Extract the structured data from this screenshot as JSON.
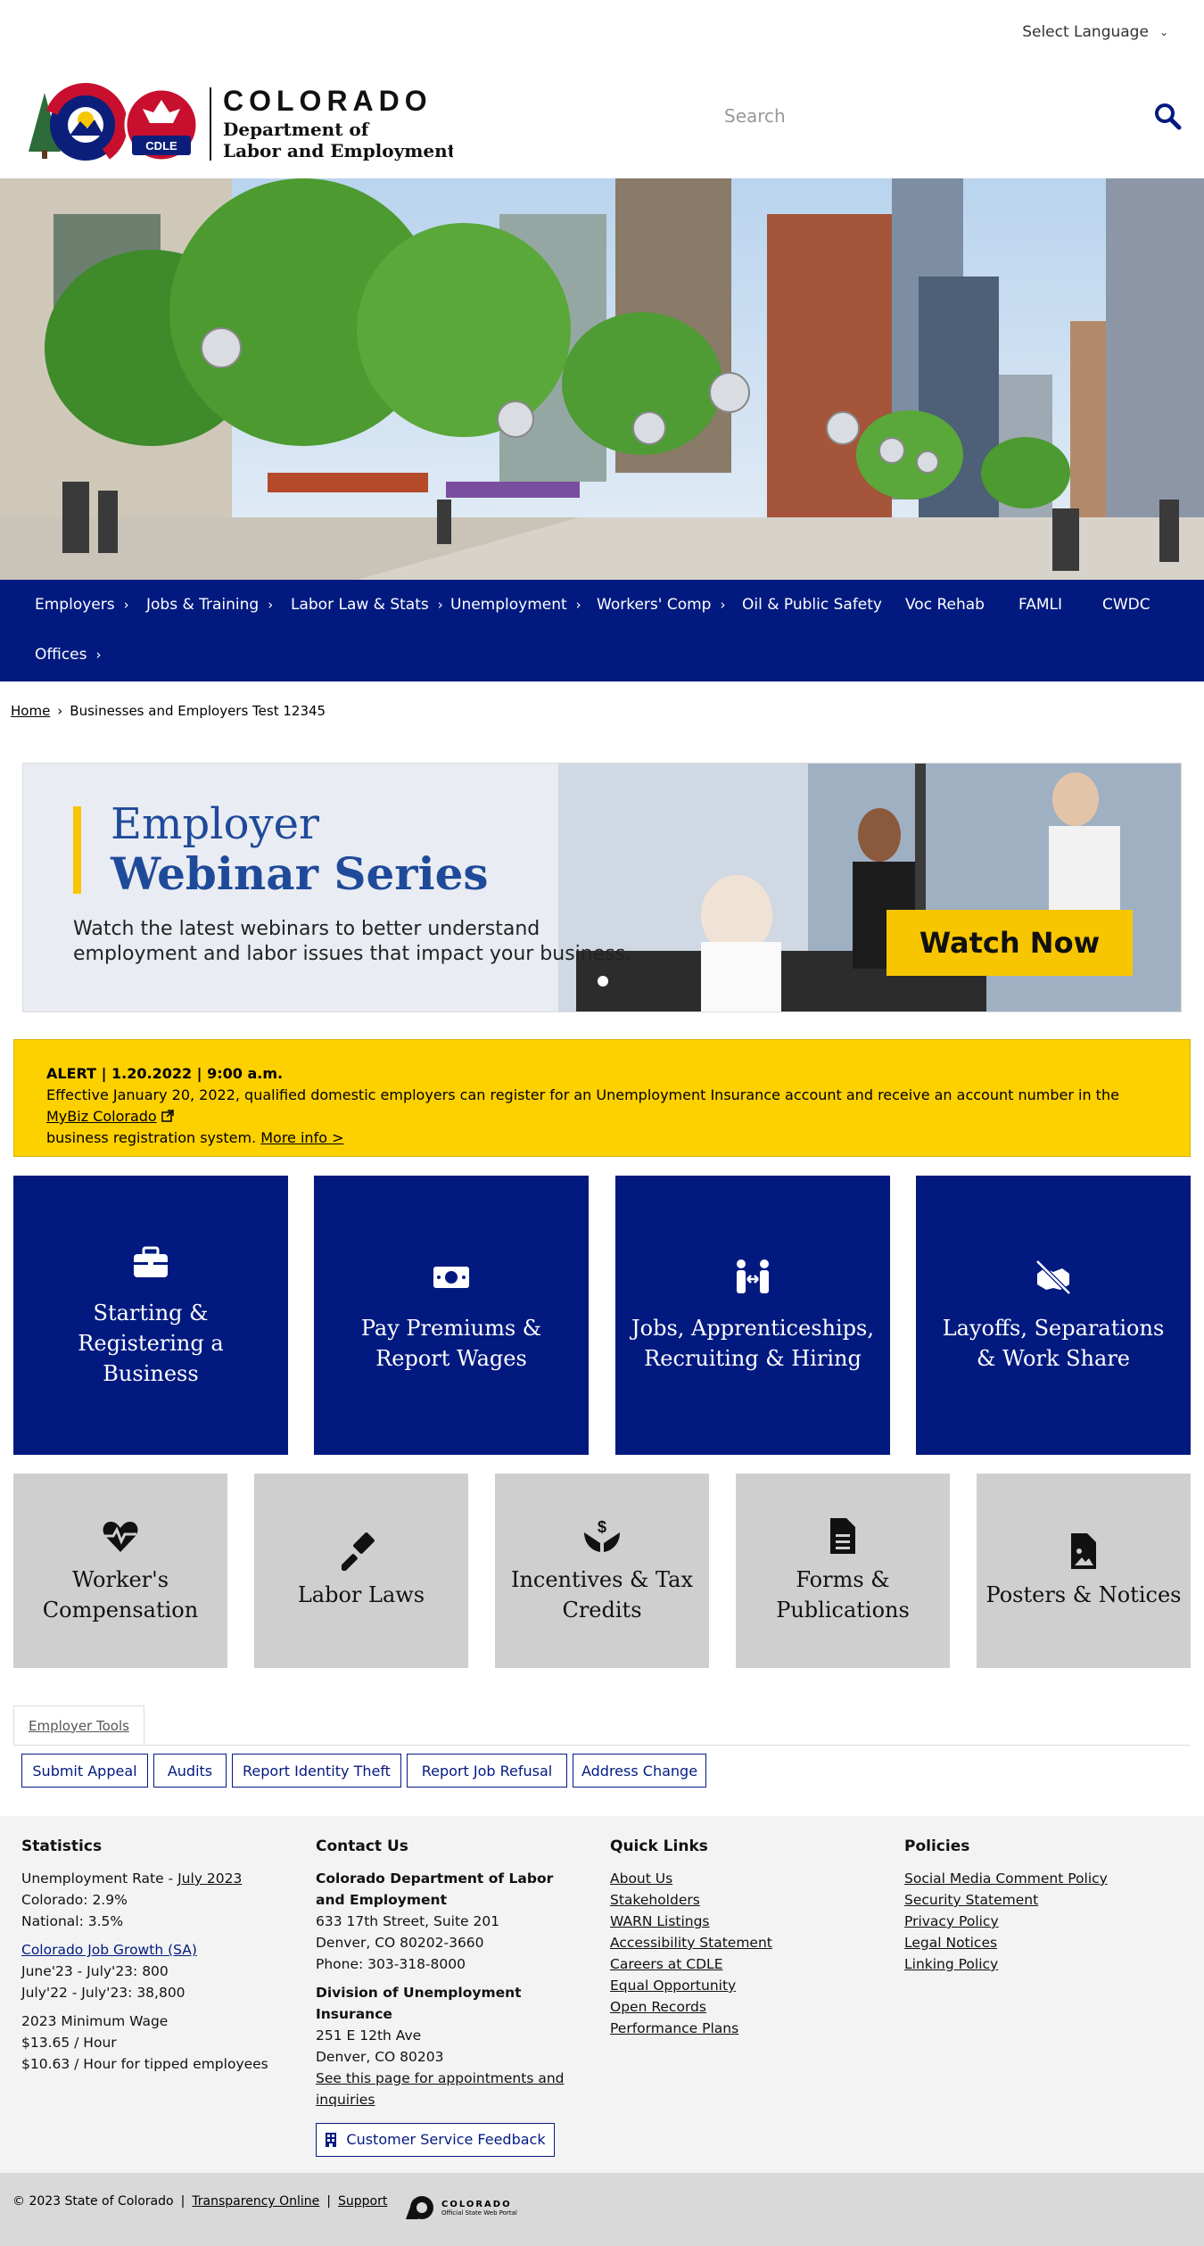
{
  "top": {
    "language_label": "Select Language"
  },
  "header": {
    "logo_state": "COLORADO",
    "logo_badge": "CDLE",
    "logo_line1": "Department of",
    "logo_line2": "Labor and Employment",
    "search_placeholder": "Search"
  },
  "nav": {
    "items": [
      {
        "label": "Employers",
        "has_sub": true
      },
      {
        "label": "Jobs & Training",
        "has_sub": true
      },
      {
        "label": "Labor Law & Stats",
        "has_sub": true
      },
      {
        "label": "Unemployment",
        "has_sub": true
      },
      {
        "label": "Workers' Comp",
        "has_sub": true
      },
      {
        "label": "Oil & Public Safety",
        "has_sub": false
      },
      {
        "label": "Voc Rehab",
        "has_sub": false
      },
      {
        "label": "FAMLI",
        "has_sub": false
      },
      {
        "label": "CWDC",
        "has_sub": false
      },
      {
        "label": "Offices",
        "has_sub": true
      }
    ],
    "caret": "›"
  },
  "breadcrumb": {
    "home": "Home",
    "sep": "›",
    "current": "Businesses and Employers Test 12345"
  },
  "banner": {
    "title_line1": "Employer",
    "title_line2": "Webinar Series",
    "subtitle": "Watch the latest webinars to better understand employment and labor issues that impact your business.",
    "cta": "Watch Now"
  },
  "alert": {
    "heading": "ALERT | 1.20.2022 | 9:00 a.m.",
    "text_before": "Effective January 20, 2022, qualified domestic employers can register for an Unemployment Insurance account and receive an account number in the ",
    "link1": "MyBiz Colorado",
    "text_after": " business registration system. ",
    "link2": "More info >"
  },
  "primary_tiles": [
    {
      "label": "Starting & Registering a Business",
      "icon": "briefcase-icon"
    },
    {
      "label": "Pay Premiums & Report Wages",
      "icon": "money-icon"
    },
    {
      "label": "Jobs, Apprenticeships, Recruiting & Hiring",
      "icon": "people-arrows-icon"
    },
    {
      "label": "Layoffs, Separations & Work Share",
      "icon": "handshake-slash-icon"
    }
  ],
  "secondary_tiles": [
    {
      "label": "Worker's Compensation",
      "icon": "heart-pulse-icon"
    },
    {
      "label": "Labor Laws",
      "icon": "gavel-icon"
    },
    {
      "label": "Incentives & Tax Credits",
      "icon": "hand-dollar-icon"
    },
    {
      "label": "Forms & Publications",
      "icon": "file-lines-icon"
    },
    {
      "label": "Posters & Notices",
      "icon": "file-image-icon"
    }
  ],
  "tools": {
    "tab_label": "Employer Tools",
    "buttons": [
      "Submit Appeal",
      "Audits",
      "Report Identity Theft",
      "Report Job Refusal",
      "Address Change"
    ]
  },
  "footer": {
    "statistics": {
      "heading": "Statistics",
      "unemp_label": "Unemployment Rate - ",
      "unemp_link": "July 2023",
      "colorado": "Colorado: 2.9%",
      "national": "National: 3.5%",
      "growth_link": "Colorado Job Growth (SA)",
      "growth1": "June'23 - July'23: 800",
      "growth2": "July'22 - July'23: 38,800",
      "wage_heading": "2023 Minimum Wage",
      "wage1": "$13.65 / Hour",
      "wage2": "$10.63 / Hour for tipped employees"
    },
    "contact": {
      "heading": "Contact Us",
      "org1": "Colorado Department of Labor and Employment",
      "addr1": "633 17th Street, Suite 201",
      "addr2": "Denver, CO  80202-3660",
      "phone": "Phone: 303-318-8000",
      "org2": "Division of Unemployment Insurance",
      "addr3": "251 E 12th Ave",
      "addr4": "Denver, CO  80203",
      "appt_link": "See this page for appointments and inquiries",
      "feedback": "Customer Service Feedback"
    },
    "quick_links": {
      "heading": "Quick Links",
      "items": [
        "About Us",
        "Stakeholders",
        "WARN Listings",
        "Accessibility Statement",
        "Careers at CDLE",
        "Equal Opportunity",
        "Open Records",
        "Performance Plans"
      ]
    },
    "policies": {
      "heading": "Policies",
      "items": [
        "Social Media Comment Policy",
        "Security Statement",
        "Privacy Policy",
        "Legal Notices",
        "Linking Policy"
      ]
    }
  },
  "bottom": {
    "copyright": "© 2023 State of Colorado",
    "sep": "|",
    "transparency": "Transparency Online",
    "support": "Support",
    "portal_name": "COLORADO",
    "portal_sub": "Official State Web Portal"
  },
  "colors": {
    "navy": "#021a80",
    "alert_yellow": "#fdd000",
    "tile_gray": "#cfcfcf",
    "banner_blue": "#1f4a9a"
  }
}
